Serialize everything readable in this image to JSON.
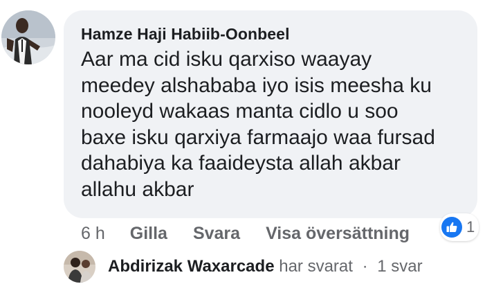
{
  "comment": {
    "author": "Hamze Haji Habiib-Oonbeel",
    "text": "Aar ma cid isku qarxiso waayay\nmeedey alshababa iyo isis meesha ku\nnooleyd wakaas manta cidlo u soo\nbaxe isku qarxiya farmaajo waa fursad\ndahabiya ka faaideysta allah akbar\nallahu akbar",
    "avatar_icon": "profile-photo",
    "bubble_color": "#f0f2f5"
  },
  "actions": {
    "time": "6 h",
    "like_label": "Gilla",
    "reply_label": "Svara",
    "translate_label": "Visa översättning"
  },
  "reaction": {
    "icon": "thumbs-up-icon",
    "count": "1",
    "color": "#1877f2"
  },
  "reply_summary": {
    "name": "Abdirizak Waxarcade",
    "action": "har svarat",
    "separator": "·",
    "count_label": "1 svar"
  }
}
